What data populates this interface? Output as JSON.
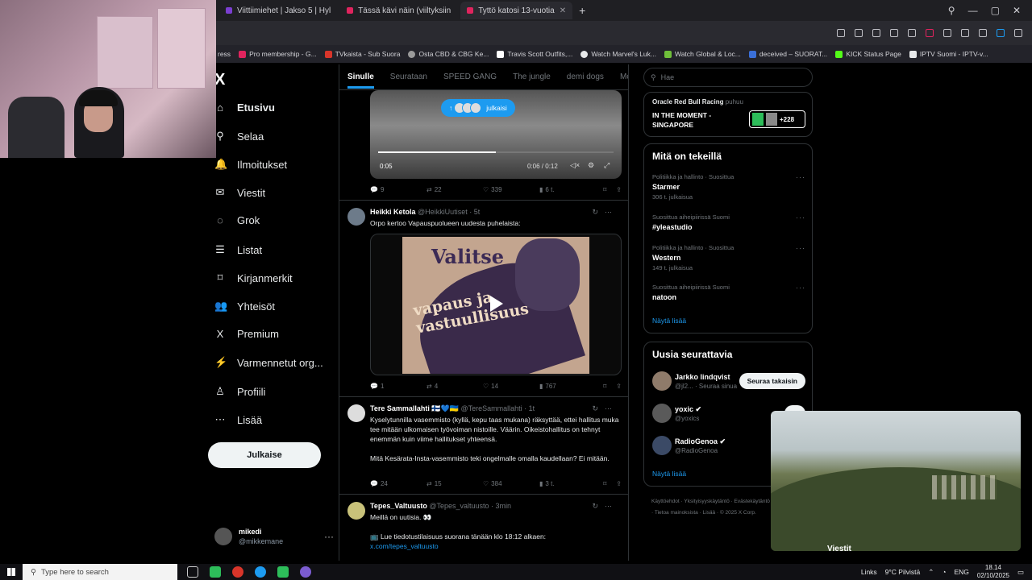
{
  "browser": {
    "tabs": [
      {
        "title": "Viittiimiehet | Jakso 5 | Hyl",
        "color": "#7b3fd1"
      },
      {
        "title": "Tässä kävi näin (viiltyksiin",
        "color": "#e0245e"
      },
      {
        "title": "Tyttö katosi 13-vuotia",
        "color": "#e0245e"
      }
    ],
    "new_tab_glyph": "+",
    "bookmarks": [
      {
        "label": "Pro membership - G...",
        "color": "#e0245e"
      },
      {
        "label": "TVkaista - Sub Suora",
        "color": "#d8352a"
      },
      {
        "label": "Osta CBD & CBG Ke...",
        "color": "#9a9a9a"
      },
      {
        "label": "Travis Scott Outfits,...",
        "color": "#ffffff"
      },
      {
        "label": "Watch Marvel's Luk...",
        "color": "#e7e9ea"
      },
      {
        "label": "Watch Global & Loc...",
        "color": "#6fbf3a"
      },
      {
        "label": "deceived – SUORAT...",
        "color": "#3a6fd8"
      },
      {
        "label": "KICK Status Page",
        "color": "#53fc18"
      },
      {
        "label": "IPTV Suomi - IPTV-v...",
        "color": "#e7e9ea"
      }
    ],
    "bookmarks_start": "ress"
  },
  "nav": {
    "logo": "X",
    "items": [
      {
        "label": "Etusivu",
        "icon": "home-icon",
        "glyph": "⌂"
      },
      {
        "label": "Selaa",
        "icon": "search-icon",
        "glyph": "⚲"
      },
      {
        "label": "Ilmoitukset",
        "icon": "bell-icon",
        "glyph": "🔔"
      },
      {
        "label": "Viestit",
        "icon": "mail-icon",
        "glyph": "✉"
      },
      {
        "label": "Grok",
        "icon": "grok-icon",
        "glyph": "◌"
      },
      {
        "label": "Listat",
        "icon": "list-icon",
        "glyph": "☰"
      },
      {
        "label": "Kirjanmerkit",
        "icon": "bookmark-icon",
        "glyph": "⌑"
      },
      {
        "label": "Yhteisöt",
        "icon": "communities-icon",
        "glyph": "👥"
      },
      {
        "label": "Premium",
        "icon": "x-premium-icon",
        "glyph": "X"
      },
      {
        "label": "Varmennetut org...",
        "icon": "lightning-icon",
        "glyph": "⚡"
      },
      {
        "label": "Profiili",
        "icon": "profile-icon",
        "glyph": "♙"
      },
      {
        "label": "Lisää",
        "icon": "more-icon",
        "glyph": "⋯"
      }
    ],
    "post_button": "Julkaise",
    "profile": {
      "name": "mikedi",
      "handle": "@mikkemane",
      "more": "···"
    }
  },
  "feed": {
    "tabs": [
      "Sinulle",
      "Seurataan",
      "SPEED GANG",
      "The jungle",
      "demi dogs",
      "McDonal"
    ],
    "active_tab": "Sinulle",
    "pill_label": "julkaisi",
    "video1": {
      "elapsed": "0:05",
      "time": "0:06 / 0:12",
      "progress": 0.5
    },
    "post1_actions": {
      "replies": "9",
      "reposts": "22",
      "likes": "339",
      "views": "6 t."
    },
    "post2": {
      "name": "Heikki Ketola",
      "handle": "@HeikkiUutiset · 5t",
      "text": "Orpo kertoo Vapauspuolueen uudesta puhelaista:",
      "poster_line1": "Valitse",
      "poster_line2": "vapaus ja vastuullisuus",
      "actions": {
        "replies": "1",
        "reposts": "4",
        "likes": "14",
        "views": "767"
      }
    },
    "post3": {
      "name": "Tere Sammallahti 🇫🇮💙🇺🇦",
      "handle": "@TereSammallahti · 1t",
      "text1": "Kyselytunnilla vasemmisto (kyllä, kepu taas mukana) räksyttää, ettei hallitus muka tee mitään ulkomaisen työvoiman nistoille. Väärin. Oikeistohallitus on tehnyt enemmän kuin viime hallitukset yhteensä.",
      "text2": "Mitä Kesärata-Insta-vasemmisto teki ongelmalle omalla kaudellaan? Ei mitään.",
      "actions": {
        "replies": "24",
        "reposts": "15",
        "likes": "384",
        "views": "3 t."
      }
    },
    "post4": {
      "name": "Tepes_Valtuusto",
      "handle": "@Tepes_valtuusto · 3min",
      "text1": "Meillä on uutisia. 👀",
      "text2": "📺 Lue tiedotustilaisuus suorana tänään klo 18:12 alkaen:",
      "link": "x.com/tepes_valtuusto"
    }
  },
  "right": {
    "search_placeholder": "Hae",
    "live": {
      "host": "Oracle Red Bull Racing",
      "status": "puhuu",
      "title": "IN THE MOMENT - SINGAPORE",
      "listeners": "+228"
    },
    "trends_title": "Mitä on tekeillä",
    "trends": [
      {
        "meta": "Politiikka ja hallinto · Suosittua",
        "topic": "Starmer",
        "count": "306 t. julkaisua"
      },
      {
        "meta": "Suosittua aiheipiirissä Suomi",
        "topic": "#yleastudio",
        "count": ""
      },
      {
        "meta": "Politiikka ja hallinto · Suosittua",
        "topic": "Western",
        "count": "149 t. julkaisua"
      },
      {
        "meta": "Suosittua aiheipiirissä Suomi",
        "topic": "natoon",
        "count": ""
      }
    ],
    "trends_more": "Näytä lisää",
    "follow_title": "Uusia seurattavia",
    "follows": [
      {
        "name": "Jarkko lindqvist",
        "handle": "@jl2... · Seuraa sinua",
        "button": "Seuraa takaisin",
        "color": "#8f7b6a"
      },
      {
        "name": "yoxic ✔",
        "handle": "@yoxics",
        "button": "S",
        "color": "#5a5a5a"
      },
      {
        "name": "RadioGenoa ✔",
        "handle": "@RadioGenoa",
        "button": "",
        "color": "#3b4a66"
      }
    ],
    "follow_more": "Näytä lisää",
    "footer": "Käyttöehdot · Yksityisyyskäytäntö · Evästekäytäntö · Tietoa mainoksista · Lisää · © 2025 X Corp."
  },
  "pip": {
    "caption": "Viestit"
  },
  "taskbar": {
    "search_placeholder": "Type here to search",
    "links": "Links",
    "weather": "9°C Pilvistä",
    "lang": "ENG",
    "time": "18.14",
    "date": "02/10/2025"
  }
}
